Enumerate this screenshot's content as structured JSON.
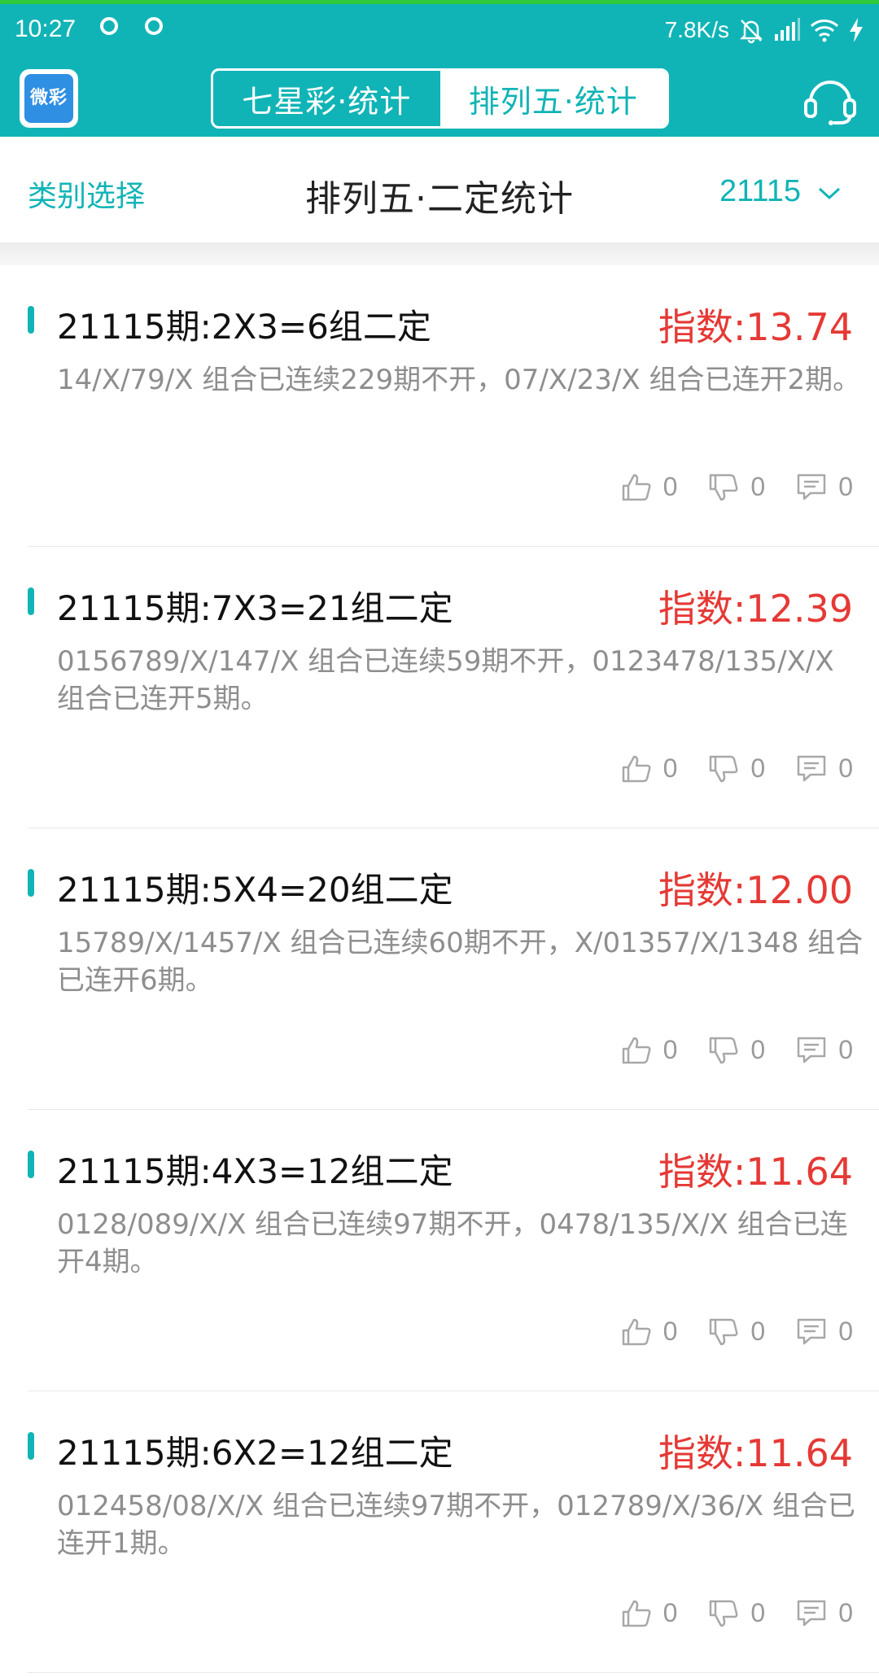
{
  "status_bar": {
    "time": "10:27",
    "net_speed": "7.8K/s"
  },
  "header": {
    "logo_text": "微彩",
    "tabs": [
      {
        "label": "七星彩·统计",
        "active": false
      },
      {
        "label": "排列五·统计",
        "active": true
      }
    ],
    "right_icon": "headset-icon"
  },
  "sub_header": {
    "category_label": "类别选择",
    "title": "排列五·二定统计",
    "period": "21115"
  },
  "colors": {
    "accent": "#11B4B6",
    "index_red": "#E53935",
    "status_top": "#31C93C"
  },
  "cards": [
    {
      "title": "21115期:2X3=6组二定",
      "index": "指数:13.74",
      "desc": "14/X/79/X 组合已连续229期不开，07/X/23/X 组合已连开2期。",
      "likes": "0",
      "dislikes": "0",
      "comments": "0"
    },
    {
      "title": "21115期:7X3=21组二定",
      "index": "指数:12.39",
      "desc": "0156789/X/147/X 组合已连续59期不开，0123478/135/X/X 组合已连开5期。",
      "likes": "0",
      "dislikes": "0",
      "comments": "0"
    },
    {
      "title": "21115期:5X4=20组二定",
      "index": "指数:12.00",
      "desc": "15789/X/1457/X 组合已连续60期不开，X/01357/X/1348 组合已连开6期。",
      "likes": "0",
      "dislikes": "0",
      "comments": "0"
    },
    {
      "title": "21115期:4X3=12组二定",
      "index": "指数:11.64",
      "desc": "0128/089/X/X 组合已连续97期不开，0478/135/X/X 组合已连开4期。",
      "likes": "0",
      "dislikes": "0",
      "comments": "0"
    },
    {
      "title": "21115期:6X2=12组二定",
      "index": "指数:11.64",
      "desc": "012458/08/X/X 组合已连续97期不开，012789/X/36/X 组合已连开1期。",
      "likes": "0",
      "dislikes": "0",
      "comments": "0"
    }
  ]
}
